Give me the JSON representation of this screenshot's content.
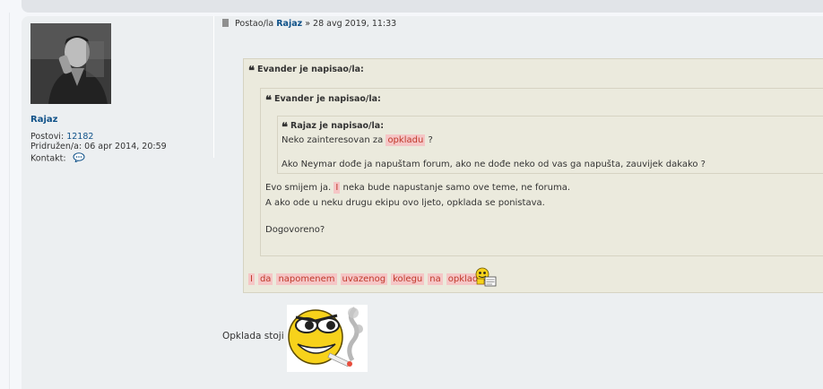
{
  "user": {
    "name": "Rajaz",
    "posts_label": "Postovi:",
    "posts_count": "12182",
    "joined_label": "Pridružen/a:",
    "joined_date": "06 apr 2014, 20:59",
    "contact_label": "Kontakt:"
  },
  "post": {
    "posted_label": "Postao/la",
    "author": "Rajaz",
    "date": "» 28 avg 2019, 11:33"
  },
  "quote_outer": {
    "cite": "Evander je napisao/la:",
    "last_words": [
      "I",
      "da",
      "napomenem",
      "uvazenog",
      "kolegu",
      "na",
      "opkladu"
    ]
  },
  "quote_middle": {
    "cite": "Evander je napisao/la:",
    "line1_pre": "Evo smijem ja.",
    "line1_hl": "I",
    "line1_post": "neka bude napustanje samo ove teme, ne foruma.",
    "line2": "A ako ode u neku drugu ekipu ovo ljeto, opklada se ponistava.",
    "line3": "Dogovoreno?"
  },
  "quote_inner": {
    "cite": "Rajaz je napisao/la:",
    "line1_pre": "Neko zainteresovan za",
    "line1_hl": "opkladu",
    "line1_post": "?",
    "line2": "Ako Neymar dođe ja napuštam forum, ako ne dođe neko od vas ga napušta, zauvijek dakako ?"
  },
  "reply_text": "Opklada stoji",
  "colors": {
    "link": "#105289",
    "highlight_bg": "#f5c6c6",
    "highlight_text": "#c0392b",
    "quote_bg": "#ebeadd"
  },
  "icons": [
    "post-file-icon",
    "chat-bubble-icon",
    "quote-icon",
    "betting-smiley-icon",
    "smoking-smiley-icon"
  ]
}
